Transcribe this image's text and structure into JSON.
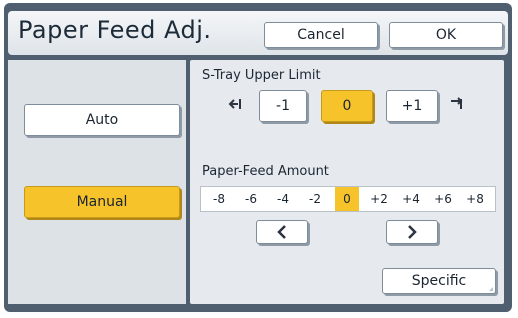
{
  "header": {
    "title": "Paper Feed Adj.",
    "cancel_label": "Cancel",
    "ok_label": "OK"
  },
  "mode": {
    "auto_label": "Auto",
    "manual_label": "Manual",
    "selected": "Manual"
  },
  "s_tray": {
    "label": "S-Tray Upper Limit",
    "options": [
      "-1",
      "0",
      "+1"
    ],
    "selected": "0"
  },
  "paper_feed": {
    "label": "Paper-Feed Amount",
    "scale": [
      "-8",
      "-6",
      "-4",
      "-2",
      "0",
      "+2",
      "+4",
      "+6",
      "+8"
    ],
    "selected": "0"
  },
  "specific_label": "Specific",
  "colors": {
    "accent": "#f6c42a",
    "frame": "#4f5f6f",
    "panel": "#e6eaee"
  },
  "icons": {
    "lower_limit": "limit-lower-icon",
    "upper_limit": "limit-upper-icon",
    "left_arrow": "chevron-left-icon",
    "right_arrow": "chevron-right-icon"
  }
}
